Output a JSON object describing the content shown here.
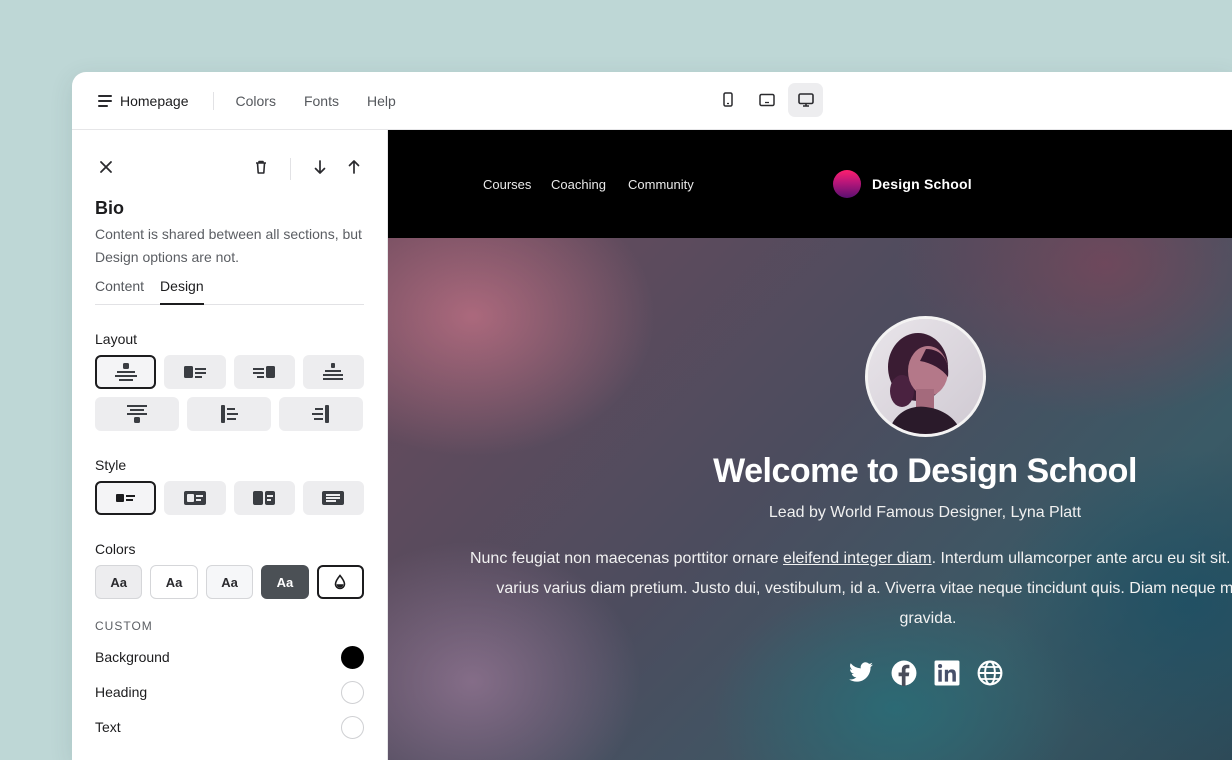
{
  "topbar": {
    "page_label": "Homepage",
    "links": [
      "Colors",
      "Fonts",
      "Help"
    ],
    "devices": [
      "phone",
      "tablet",
      "desktop"
    ],
    "active_device": "desktop"
  },
  "panel": {
    "title": "Bio",
    "description": "Content is shared between all sections, but Design options are not.",
    "tabs": [
      "Content",
      "Design"
    ],
    "active_tab": "Design",
    "layout_label": "Layout",
    "style_label": "Style",
    "colors_label": "Colors",
    "color_swatches": [
      "Aa",
      "Aa",
      "Aa",
      "Aa"
    ],
    "custom_label": "CUSTOM",
    "custom_colors": {
      "background": {
        "label": "Background",
        "color": "#000000"
      },
      "heading": {
        "label": "Heading",
        "color": "#ffffff"
      },
      "text": {
        "label": "Text",
        "color": "#ffffff"
      }
    }
  },
  "site": {
    "nav": [
      "Courses",
      "Coaching",
      "Community"
    ],
    "brand": "Design School",
    "hero_title": "Welcome to Design School",
    "hero_subtitle": "Lead by World Famous Designer, Lyna Platt",
    "body_before_link": "Nunc feugiat non maecenas porttitor ornare ",
    "body_link": "eleifend integer diam",
    "body_after_link": ". Interdum ullamcorper ante arcu eu sit sit. Placerat viverra dolor varius varius diam pretium. Justo dui, vestibulum, id a. Viverra vitae neque tincidunt quis. Diam neque magna nullam enim gravida.",
    "social_icons": [
      "twitter-icon",
      "facebook-icon",
      "linkedin-icon",
      "globe-icon"
    ]
  },
  "colors": {
    "accent": "#1c1c1e",
    "selected_swatch_bg": "#4b5055",
    "nav_bg": "#000000"
  }
}
